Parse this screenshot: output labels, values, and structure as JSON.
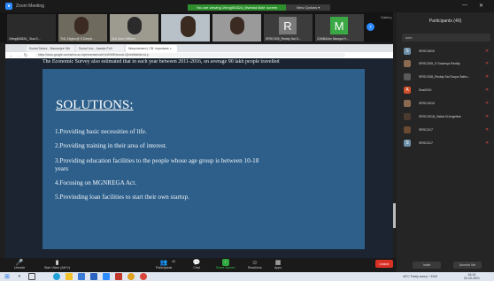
{
  "window": {
    "app_title": "Zoom Meeting",
    "gallery_label": "Gallery",
    "minimize": "—",
    "close": "✕"
  },
  "banner": {
    "text": "You are viewing 19mpj0t1824_Mwrsha Bole' screen",
    "view_options": "View Options ▾"
  },
  "thumbnails": [
    {
      "name": "19mpj0t1824_ Sua S..."
    },
    {
      "name": "TN1.19pjeu@ S Deepti..."
    },
    {
      "name": "DrA John William"
    },
    {
      "name": ""
    },
    {
      "name": "SRSC005_Reddy Sai S..."
    },
    {
      "name": "21MBA0xx Naraya H..."
    }
  ],
  "tile_letters": {
    "r": "R",
    "m": "M"
  },
  "browser": {
    "tabs": [
      "Social Sector - Bannerjee 'Mh",
      "Social Voc., Jaanke Pu3",
      "Wmpvlement | CB: Importans ×"
    ],
    "url": "https://docs.google.com/a/ncs.ac.in/presentation/d/1eW/HBNexodLrQr/edit#slide=id.p"
  },
  "slide": {
    "top_text": "The Economic Survey also estimated that in each year between 2011-2016, on average 90 lakh people travelled",
    "title": "SOLUTIONS:",
    "points": [
      "1.Providing basic necessities of life.",
      "2.Providing training in their area of interest.",
      "3.Providing education facilities to the people whose age group is between 10-18",
      "years",
      "4.Focusing on MGNREGA Act.",
      "5.Provinding loan facilities to start their own startup."
    ]
  },
  "toolbar": {
    "unmute": "Unmute",
    "start_video": "Start Video (Alt+V)",
    "participants": "Participants",
    "participants_count": "40",
    "chat": "Chat",
    "share_screen": "Share Screen",
    "reactions": "Reactions",
    "apps": "Apps",
    "end": "Leave"
  },
  "participants_panel": {
    "title": "Participants (40)",
    "search_value": "sme",
    "rows": [
      {
        "initial": "S",
        "color": "#6d8fa8",
        "name": "SRSC0810"
      },
      {
        "initial": "",
        "color": "#8a6a50",
        "name": "SRSC005_S Sowmya Reddy"
      },
      {
        "initial": "",
        "color": "#5a5a5a",
        "name": "SRSC008_Reddy Sai Surya Sathv..."
      },
      {
        "initial": "A",
        "color": "#d0502a",
        "name": "Sna0910"
      },
      {
        "initial": "",
        "color": "#8a6a50",
        "name": "SRSC0010"
      },
      {
        "initial": "",
        "color": "#4a3a30",
        "name": "SRSC0018_Sakia N.Angelina"
      },
      {
        "initial": "",
        "color": "#6a4a30",
        "name": "SRSC017"
      },
      {
        "initial": "S",
        "color": "#6d8fa8",
        "name": "SRSC017"
      }
    ],
    "invite": "Invite",
    "unmute_me": "Unmute Me"
  },
  "taskbar": {
    "status": "40°C Partly sunny  ^  ENG",
    "time": "16:19",
    "date": "22-10-2021"
  }
}
